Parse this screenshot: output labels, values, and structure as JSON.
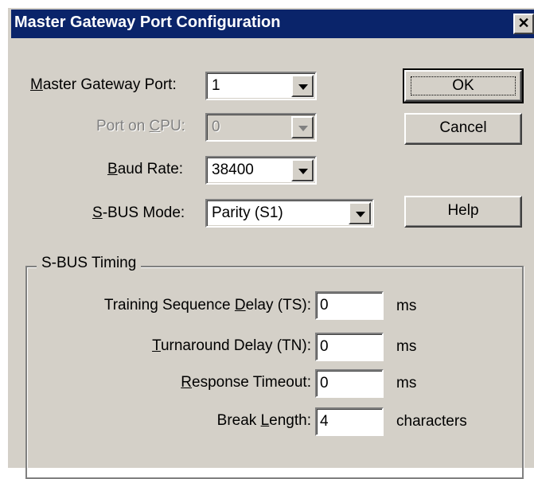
{
  "window": {
    "title": "Master Gateway Port Configuration",
    "close_glyph": "✕"
  },
  "fields": {
    "master_gateway_port": {
      "label_key": "M",
      "label_rest": "aster Gateway Port:",
      "value": "1"
    },
    "port_on_cpu": {
      "label_pre": "Port on ",
      "label_key": "C",
      "label_rest": "PU:",
      "value": "0"
    },
    "baud_rate": {
      "label_key": "B",
      "label_rest": "aud Rate:",
      "value": "38400"
    },
    "sbus_mode": {
      "label_key": "S",
      "label_rest": "-BUS Mode:",
      "value": "Parity (S1)"
    }
  },
  "buttons": {
    "ok": "OK",
    "cancel": "Cancel",
    "help": "Help"
  },
  "timing": {
    "group_title": "S-BUS Timing",
    "rows": [
      {
        "label_pre": "Training Sequence ",
        "label_key": "D",
        "label_rest": "elay (TS):",
        "value": "0",
        "unit": "ms"
      },
      {
        "label_pre": "",
        "label_key": "T",
        "label_rest": "urnaround Delay (TN):",
        "value": "0",
        "unit": "ms"
      },
      {
        "label_pre": "",
        "label_key": "R",
        "label_rest": "esponse Timeout:",
        "value": "0",
        "unit": "ms"
      },
      {
        "label_pre": "Break ",
        "label_key": "L",
        "label_rest": "ength:",
        "value": "4",
        "unit": "characters"
      }
    ]
  }
}
